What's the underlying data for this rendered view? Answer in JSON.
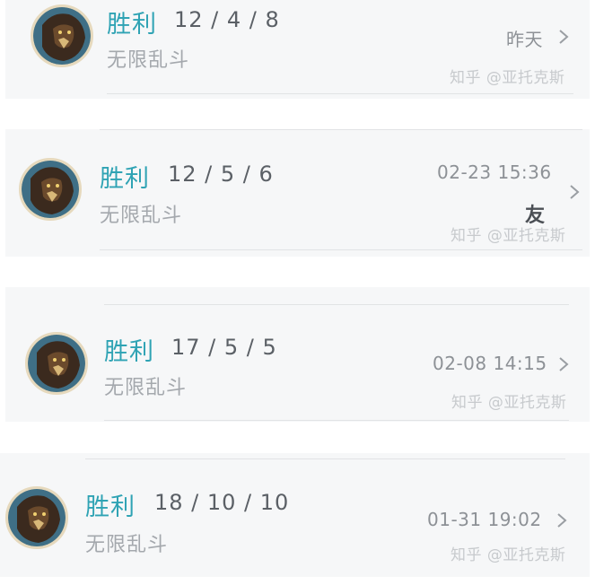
{
  "matches": [
    {
      "result": "胜利",
      "kda": "12 / 4 / 8",
      "mode": "无限乱斗",
      "time": "昨天",
      "watermark": "知乎 @亚托克斯"
    },
    {
      "result": "胜利",
      "kda": "12 / 5 / 6",
      "mode": "无限乱斗",
      "time": "02-23 15:36",
      "badge": "友",
      "watermark": "知乎 @亚托克斯"
    },
    {
      "result": "胜利",
      "kda": "17 / 5 / 5",
      "mode": "无限乱斗",
      "time": "02-08 14:15",
      "watermark": "知乎 @亚托克斯"
    },
    {
      "result": "胜利",
      "kda": "18 / 10 / 10",
      "mode": "无限乱斗",
      "time": "01-31 19:02",
      "watermark": "知乎 @亚托克斯"
    }
  ],
  "colors": {
    "result": "#2fa3b4",
    "card_bg": "#f6f7f8",
    "divider": "#e1e3e5"
  },
  "icons": {
    "avatar": "champion-portrait-icon",
    "arrow": "chevron-right-icon"
  }
}
